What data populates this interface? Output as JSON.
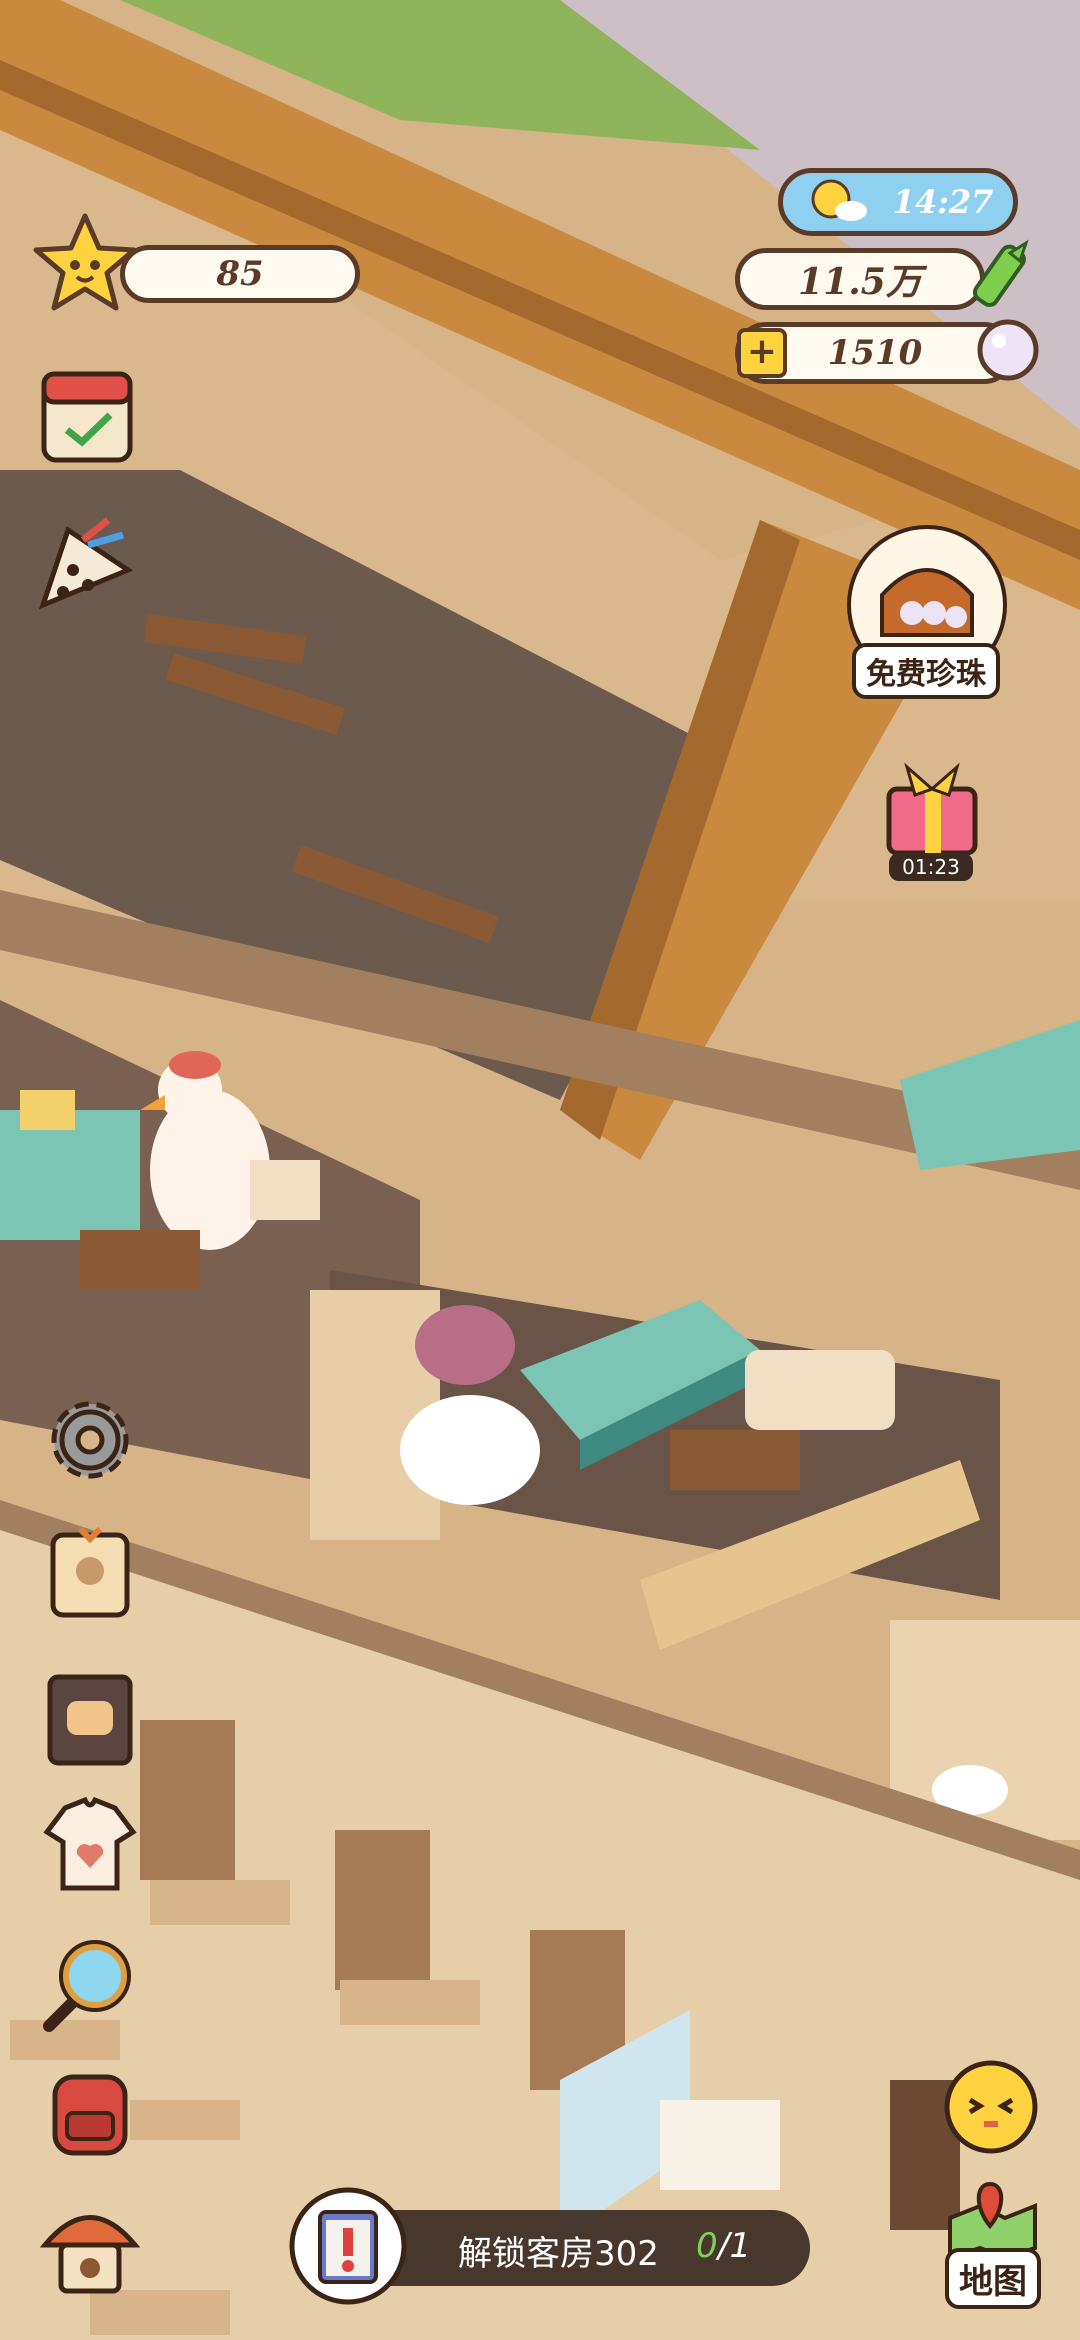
{
  "hud": {
    "stars": "85",
    "time": "14:27",
    "currency": "11.5万",
    "pearls": "1510"
  },
  "side_buttons": {
    "free_pearls_label": "免费珍珠",
    "gift_timer": "01:23",
    "map_label": "地图"
  },
  "task_bar": {
    "text": "解锁客房302",
    "progress_done": "0",
    "progress_total": "/1"
  },
  "colors": {
    "outline": "#5a3b28",
    "pill_bg": "#fffaf0",
    "task_bg": "#3a2a22",
    "progress_green": "#7fd05b",
    "time_bg": "#8fd0f0"
  }
}
